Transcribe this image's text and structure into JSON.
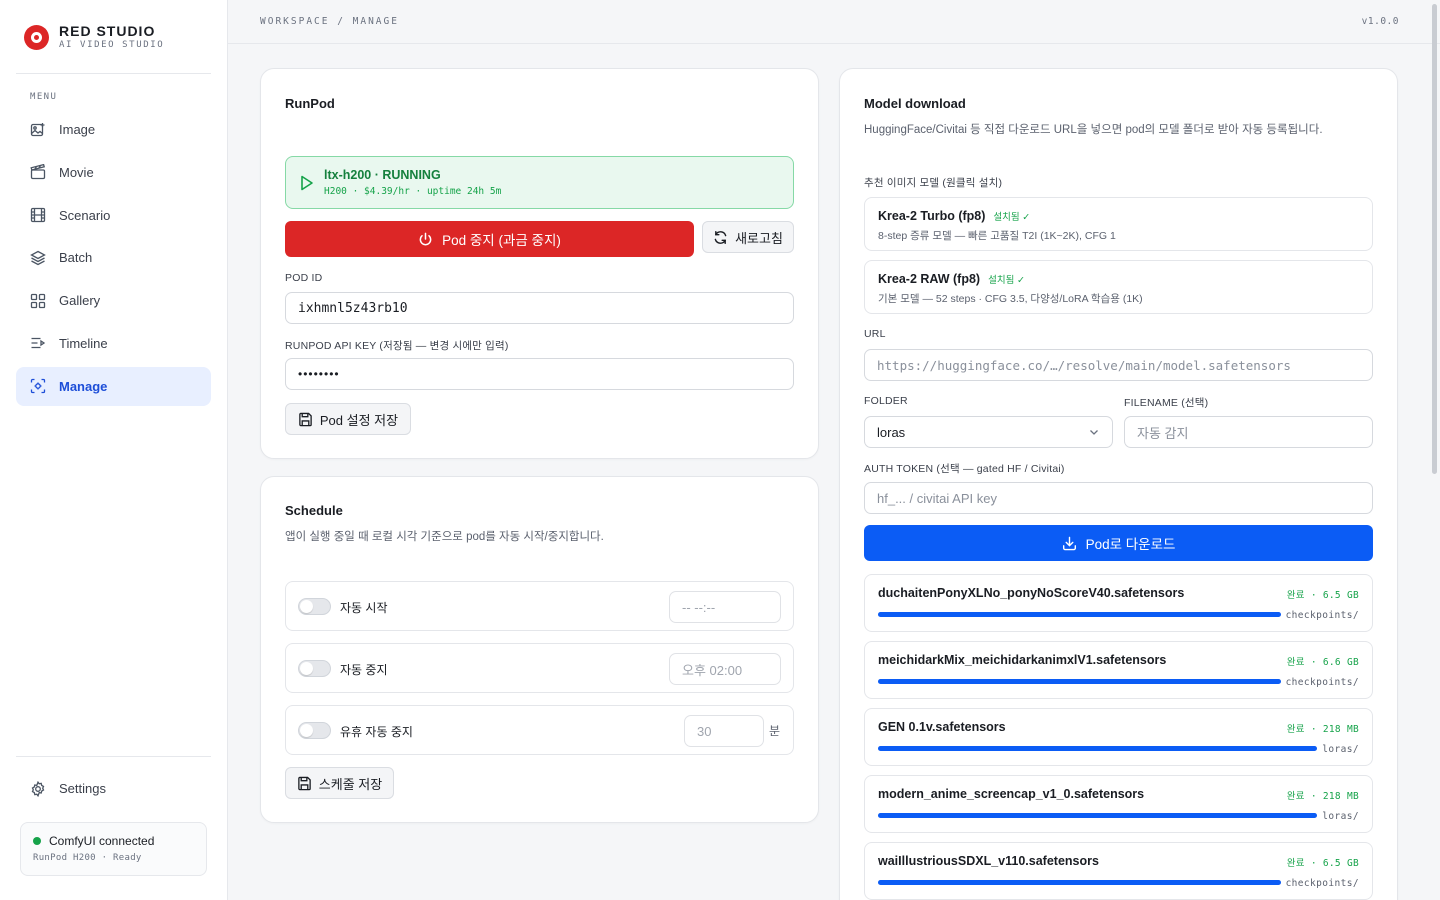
{
  "brand": {
    "name": "RED STUDIO",
    "subtitle": "AI VIDEO STUDIO"
  },
  "sidebar": {
    "menu_label": "MENU",
    "items": [
      {
        "label": "Image",
        "icon": "image-plus-icon"
      },
      {
        "label": "Movie",
        "icon": "clapperboard-icon"
      },
      {
        "label": "Scenario",
        "icon": "film-icon"
      },
      {
        "label": "Batch",
        "icon": "layers-icon"
      },
      {
        "label": "Gallery",
        "icon": "grid-icon"
      },
      {
        "label": "Timeline",
        "icon": "timeline-icon"
      },
      {
        "label": "Manage",
        "icon": "manage-icon",
        "active": true
      }
    ],
    "settings_label": "Settings",
    "connection": {
      "title": "ComfyUI connected",
      "sub": "RunPod H200 · Ready",
      "color": "#16a34a"
    }
  },
  "header": {
    "breadcrumb": "WORKSPACE / MANAGE",
    "version": "v1.0.0"
  },
  "runpod": {
    "title": "RunPod",
    "status": {
      "title": "ltx-h200 · RUNNING",
      "sub": "H200 · $4.39/hr · uptime 24h 5m"
    },
    "stop_button": "Pod 중지 (과금 중지)",
    "refresh_button": "새로고침",
    "pod_id_label": "POD ID",
    "pod_id_value": "ixhmnl5z43rb10",
    "api_key_label": "RUNPOD API KEY (저장됨 — 변경 시에만 입력)",
    "api_key_value": "••••••••",
    "save_button": "Pod 설정 저장"
  },
  "schedule": {
    "title": "Schedule",
    "desc": "앱이 실행 중일 때 로컬 시각 기준으로 pod를 자동 시작/중지합니다.",
    "rows": [
      {
        "label": "자동 시작",
        "value": "-- --:--"
      },
      {
        "label": "자동 중지",
        "value": "오후 02:00"
      },
      {
        "label": "유휴 자동 중지",
        "value": "30",
        "unit": "분"
      }
    ],
    "save_button": "스케줄 저장"
  },
  "model_download": {
    "title": "Model download",
    "desc": "HuggingFace/Civitai 등 직접 다운로드 URL을 넣으면 pod의 모델 폴더로 받아 자동 등록됩니다.",
    "recommended_label": "추천 이미지 모델 (원클릭 설치)",
    "recommended": [
      {
        "name": "Krea-2 Turbo (fp8)",
        "badge": "설치됨 ✓",
        "desc": "8-step 증류 모델 — 빠른 고품질 T2I (1K~2K), CFG 1"
      },
      {
        "name": "Krea-2 RAW (fp8)",
        "badge": "설치됨 ✓",
        "desc": "기본 모델 — 52 steps · CFG 3.5, 다양성/LoRA 학습용 (1K)"
      }
    ],
    "url_label": "URL",
    "url_placeholder": "https://huggingface.co/…/resolve/main/model.safetensors",
    "folder_label": "FOLDER",
    "folder_value": "loras",
    "filename_label": "FILENAME (선택)",
    "filename_placeholder": "자동 감지",
    "auth_label": "AUTH TOKEN (선택 — gated HF / Civitai)",
    "auth_placeholder": "hf_... / civitai API key",
    "download_button": "Pod로 다운로드",
    "downloads": [
      {
        "name": "duchaitenPonyXLNo_ponyNoScoreV40.safetensors",
        "status": "완료 · 6.5 GB",
        "folder": "checkpoints/",
        "progress": 100
      },
      {
        "name": "meichidarkMix_meichidarkanimxlV1.safetensors",
        "status": "완료 · 6.6 GB",
        "folder": "checkpoints/",
        "progress": 100
      },
      {
        "name": "GEN 0.1v.safetensors",
        "status": "완료 · 218 MB",
        "folder": "loras/",
        "progress": 100
      },
      {
        "name": "modern_anime_screencap_v1_0.safetensors",
        "status": "완료 · 218 MB",
        "folder": "loras/",
        "progress": 100
      },
      {
        "name": "waiIllustriousSDXL_v110.safetensors",
        "status": "완료 · 6.5 GB",
        "folder": "checkpoints/",
        "progress": 100
      }
    ]
  },
  "colors": {
    "accent": "#0b5cf5",
    "danger": "#dc2626",
    "success": "#16a34a"
  }
}
